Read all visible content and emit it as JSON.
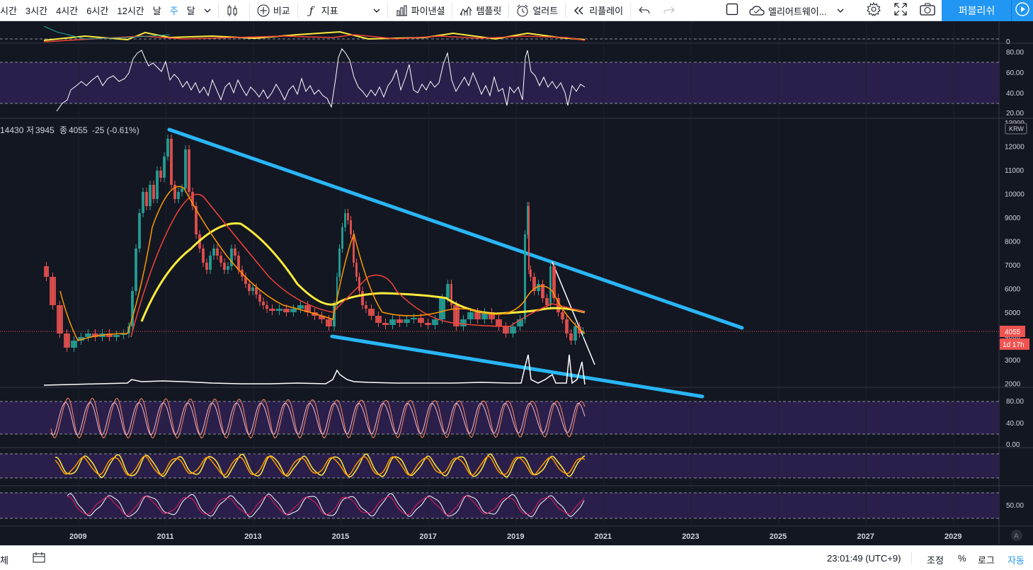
{
  "toolbar": {
    "intervals": [
      "시간",
      "3시간",
      "4시간",
      "6시간",
      "12시간",
      "날",
      "주",
      "달"
    ],
    "active_interval": "주",
    "compare": "비교",
    "indicators": "지표",
    "financials": "파이낸셜",
    "templates": "템플릿",
    "alerts": "얼러트",
    "replay": "리플레이",
    "layout_name": "엘리어트웨이...",
    "publish": "퍼블리쉬"
  },
  "chart": {
    "price_scale_labels": [
      "13000",
      "12000",
      "11000",
      "10000",
      "9000",
      "8000",
      "7000",
      "6000",
      "5000",
      "4000",
      "3000",
      "2000"
    ],
    "currency_badge": "KRW",
    "last_price": "4055",
    "countdown": "1d 17h",
    "legend": {
      "high_value": "14430",
      "low_label": "저",
      "low_value": "3945",
      "close_label": "종",
      "close_value": "4055",
      "change": "-25 (-0.61%)"
    },
    "rsi_scale": [
      "0",
      "80.00",
      "60.00",
      "40.00",
      "20.00"
    ],
    "stoch_scale": [
      "80.00",
      "40.00",
      "0.00"
    ],
    "osc_scale": [
      "50.00"
    ],
    "time_labels": [
      "2009",
      "2011",
      "2013",
      "2015",
      "2017",
      "2019",
      "2021",
      "2023",
      "2025",
      "2027",
      "2029"
    ],
    "auto_badge": "A",
    "colors": {
      "background": "#131722",
      "trendline": "#29b6f6",
      "ma_yellow": "#ffeb3b",
      "ma_orange": "#ff9800",
      "ma_red": "#f44336",
      "price_line": "#ef5350",
      "pane_band": "#2a1f4a"
    }
  },
  "bottombar": {
    "left_label": "체",
    "time": "23:01:49 (UTC+9)",
    "adjust": "조정",
    "percent": "%",
    "log": "로그",
    "auto": "자동"
  }
}
